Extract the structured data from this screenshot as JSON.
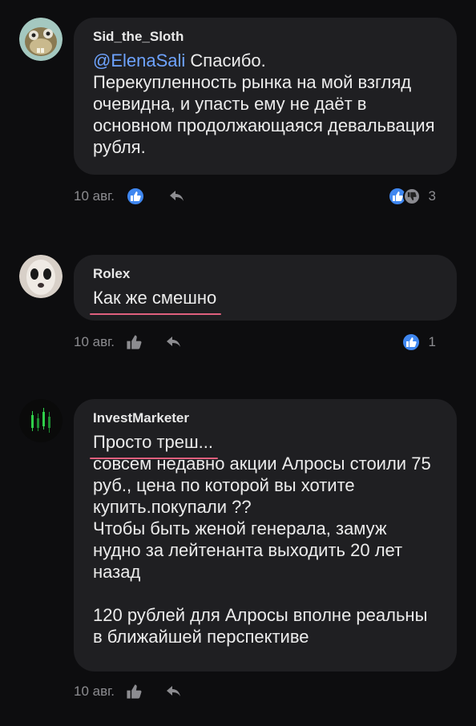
{
  "comments": [
    {
      "author": "Sid_the_Sloth",
      "mention": "@ElenaSali",
      "text_after_mention": " Спасибо.\nПерекупленность рынка на мой взгляд очевидна, и упасть ему не даёт в основном продолжающаяся девальвация рубля.",
      "date": "10 авг.",
      "reaction_count": "3"
    },
    {
      "author": "Rolex",
      "text": "Как же смешно",
      "date": "10 авг.",
      "reaction_count": "1"
    },
    {
      "author": "InvestMarketer",
      "first_line": "Просто треш...",
      "text": "совсем недавно акции Алросы стоили 75 руб., цена по которой вы хотите купить.покупали ??\nЧтобы быть женой генерала, замуж нудно за лейтенанта выходить 20 лет назад\n\n120 рублей для Алросы вполне реальны в ближайшей перспективе",
      "date": "10 авг."
    }
  ],
  "colors": {
    "background": "#0d0d0f",
    "bubble": "#1f1f22",
    "mention": "#6ea3ff",
    "like_accent": "#3f87f0",
    "underline": "#e0607e"
  },
  "icons": [
    "thumbs-up-icon",
    "reply-icon",
    "thumbs-down-icon"
  ]
}
